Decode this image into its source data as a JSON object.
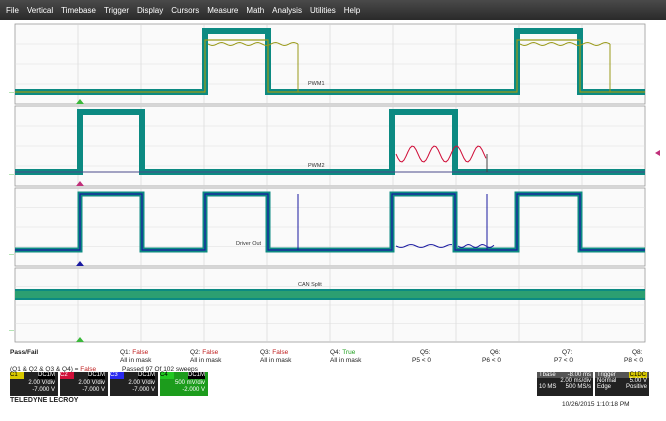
{
  "menu": [
    "File",
    "Vertical",
    "Timebase",
    "Trigger",
    "Display",
    "Cursors",
    "Measure",
    "Math",
    "Analysis",
    "Utilities",
    "Help"
  ],
  "traces": {
    "pwm1": "PWM1",
    "pwm2": "PWM2",
    "driver": "Driver Out",
    "can": "CAN Split"
  },
  "colors": {
    "mask": "#0c8a82",
    "pwm1": "#9a9a1a",
    "pwm2": "#d0103a",
    "driver": "#1a1aa0",
    "can": "#3aa86a",
    "trigger": "#c0307a",
    "gnd": "#3ab83a"
  },
  "passfail": {
    "title": "Pass/Fail",
    "q1": {
      "label": "Q1:",
      "state": "False",
      "desc": "All in mask"
    },
    "q2": {
      "label": "Q2:",
      "state": "False",
      "desc": "All in mask"
    },
    "q3": {
      "label": "Q3:",
      "state": "False",
      "desc": "All in mask"
    },
    "q4": {
      "label": "Q4:",
      "state": "True",
      "desc": "All in mask"
    },
    "q5": {
      "label": "Q5:",
      "desc": "P5 < 0"
    },
    "q6": {
      "label": "Q6:",
      "desc": "P6 < 0"
    },
    "q7": {
      "label": "Q7:",
      "desc": "P7 < 0"
    },
    "q8": {
      "label": "Q8:",
      "desc": "P8 < 0"
    },
    "logic": "(Q1 & Q2 & Q3 & Q4) =",
    "logic_state": "False",
    "passed": "Passed  97  Of  102  sweeps"
  },
  "channels": [
    {
      "name": "C1",
      "tag": "DC1M",
      "vdiv": "2.00 V/div",
      "offset": "-7.000 V",
      "color": "#d8c800"
    },
    {
      "name": "C2",
      "tag": "DC1M",
      "vdiv": "2.00 V/div",
      "offset": "-7.000 V",
      "color": "#d0103a"
    },
    {
      "name": "C3",
      "tag": "DC1M",
      "vdiv": "2.00 V/div",
      "offset": "-7.000 V",
      "color": "#2a2af0"
    },
    {
      "name": "C4",
      "tag": "DC1M",
      "vdiv": "500 mV/div",
      "offset": "-2.000 V",
      "color": "#22c822"
    }
  ],
  "timebase": {
    "label": "Tbase",
    "delay": "-8.00 ms",
    "tdiv": "2.00 ms/div",
    "samples": "10 MS",
    "rate": "500 MS/s"
  },
  "trigger": {
    "label": "Trigger",
    "tag": "C1DC",
    "mode": "Normal",
    "level": "5.00 V",
    "type": "Edge",
    "slope": "Positive"
  },
  "brand": "TELEDYNE LECROY",
  "timestamp": "10/26/2015 1:10:18 PM"
}
